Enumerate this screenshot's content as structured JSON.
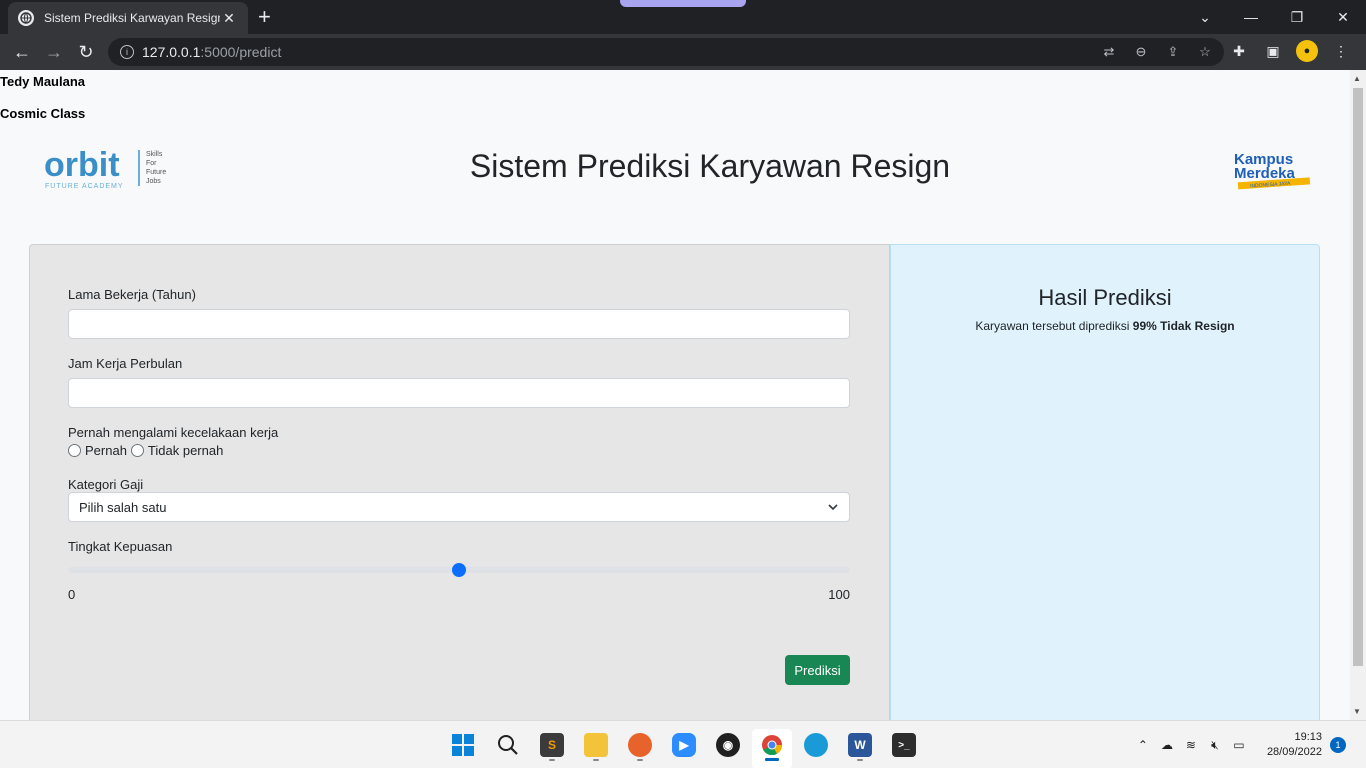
{
  "browser": {
    "tab_title": "Sistem Prediksi Karwayan Resign",
    "url_host": "127.0.0.1",
    "url_path": ":5000/predict"
  },
  "page": {
    "author_name": "Tedy Maulana",
    "author_class": "Cosmic Class",
    "title": "Sistem Prediksi Karyawan Resign",
    "logo_left": "orbit",
    "logo_right": "Kampus Merdeka"
  },
  "form": {
    "lama_label": "Lama Bekerja (Tahun)",
    "lama_value": "",
    "jam_label": "Jam Kerja Perbulan",
    "jam_value": "",
    "kecelakaan_label": "Pernah mengalami kecelakaan kerja",
    "radio_options": [
      "Pernah",
      "Tidak pernah"
    ],
    "gaji_label": "Kategori Gaji",
    "gaji_selected": "Pilih salah satu",
    "kepuasan_label": "Tingkat Kepuasan",
    "kepuasan_min": "0",
    "kepuasan_max": "100",
    "kepuasan_value": 50,
    "submit_label": "Prediksi"
  },
  "result": {
    "title": "Hasil Prediksi",
    "text_prefix": "Karyawan tersebut diprediksi",
    "text_bold": "99% Tidak Resign"
  },
  "taskbar": {
    "apps": [
      "windows-start-icon",
      "search-icon",
      "sublime-text-icon",
      "file-explorer-icon",
      "firefox-icon",
      "zoom-icon",
      "obs-icon",
      "chrome-icon",
      "edge-icon",
      "word-icon",
      "terminal-icon"
    ],
    "time": "19:13",
    "date": "28/09/2022",
    "notification_count": "1"
  },
  "colors": {
    "primary_button": "#198754",
    "slider": "#0d6efd",
    "result_bg": "#e0f3fc",
    "form_bg": "#e6e6e6"
  }
}
